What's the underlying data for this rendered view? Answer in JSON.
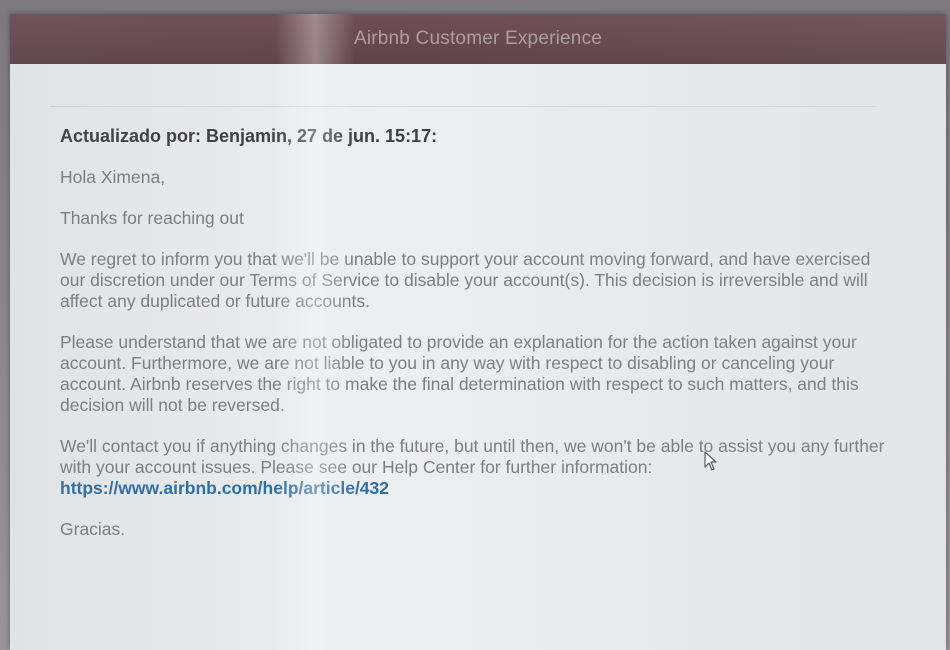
{
  "window": {
    "title": "Airbnb Customer Experience"
  },
  "message": {
    "heading": "Actualizado por: Benjamin, 27 de jun. 15:17:",
    "greeting": "Hola Ximena,",
    "thanks": "Thanks for reaching out",
    "para1": "We regret to inform you that we'll be unable to support your account moving forward, and have exercised our discretion under our Terms of Service to disable your account(s). This decision is irreversible and will affect any duplicated or future accounts.",
    "para2": "Please understand that we are not obligated to provide an explanation for the action taken against your account. Furthermore, we are not liable to you in any way with respect to disabling or canceling your account. Airbnb reserves the right to make the final determination with respect to such matters, and this decision will not be reversed.",
    "para3_text": "We'll contact you if anything changes in the future, but until then, we won't be able to assist you any further with your account issues. Please see our Help Center for further information:",
    "help_link": "https://www.airbnb.com/help/article/432",
    "signoff": "Gracias."
  },
  "icons": {
    "cursor": "mouse-pointer-icon"
  }
}
